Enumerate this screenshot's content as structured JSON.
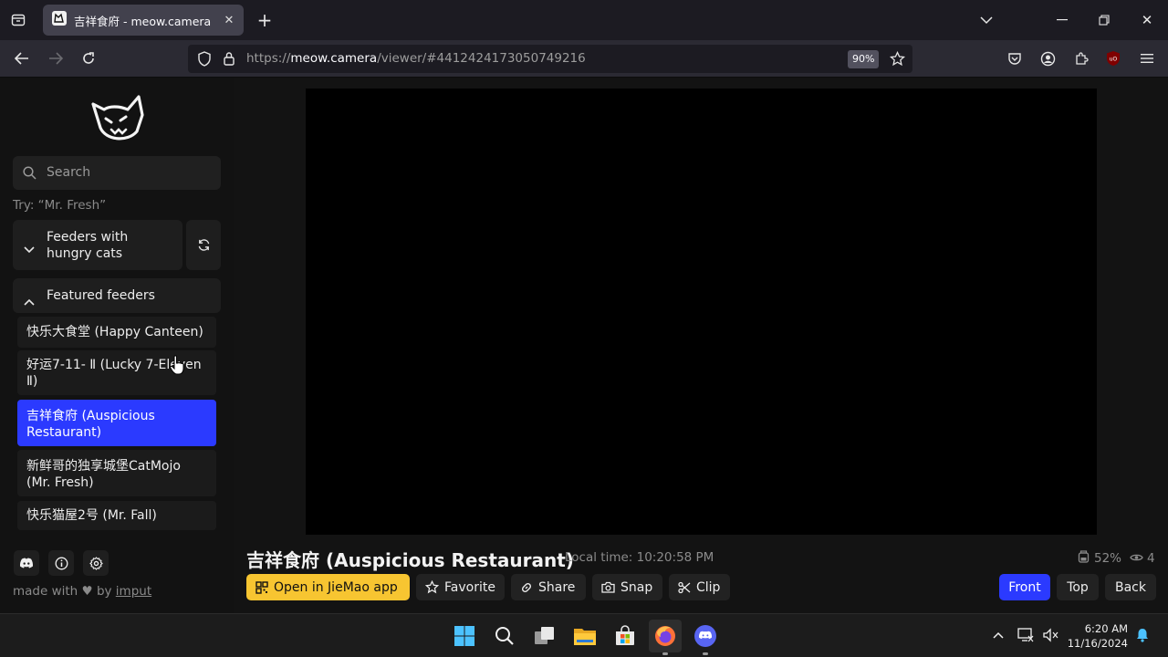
{
  "browser": {
    "tab_title": "吉祥食府 - meow.camera",
    "url_scheme": "https://",
    "url_host": "meow.camera",
    "url_path": "/viewer/#4412424173050749216",
    "zoom": "90%"
  },
  "sidebar": {
    "search_placeholder": "Search",
    "hint": "Try: “Mr. Fresh”",
    "hungry_section_label": "Feeders with hungry cats",
    "featured_section_label": "Featured feeders",
    "featured_feeders": [
      "快乐大食堂 (Happy Canteen)",
      "好运7-11- Ⅱ (Lucky 7-Eleven Ⅱ)",
      "吉祥食府 (Auspicious Restaurant)",
      "新鲜哥的独享城堡CatMojo (Mr. Fresh)",
      "快乐猫屋2号 (Mr. Fall)"
    ],
    "active_feeder_index": 2,
    "footer_prefix": "made with",
    "footer_by": "by",
    "footer_link": "imput"
  },
  "viewer": {
    "title": "吉祥食府 (Auspicious Restaurant)",
    "local_time": "Local time: 10:20:58 PM",
    "food_level": "52%",
    "viewers": "4",
    "buttons": {
      "open_app": "Open in JieMao app",
      "favorite": "Favorite",
      "share": "Share",
      "snap": "Snap",
      "clip": "Clip"
    },
    "camera_views": [
      "Front",
      "Top",
      "Back"
    ],
    "active_view": "Front"
  },
  "taskbar": {
    "time": "6:20 AM",
    "date": "11/16/2024"
  },
  "colors": {
    "accent_blue": "#2b3aff",
    "accent_yellow": "#f7c531",
    "background": "#131313"
  }
}
